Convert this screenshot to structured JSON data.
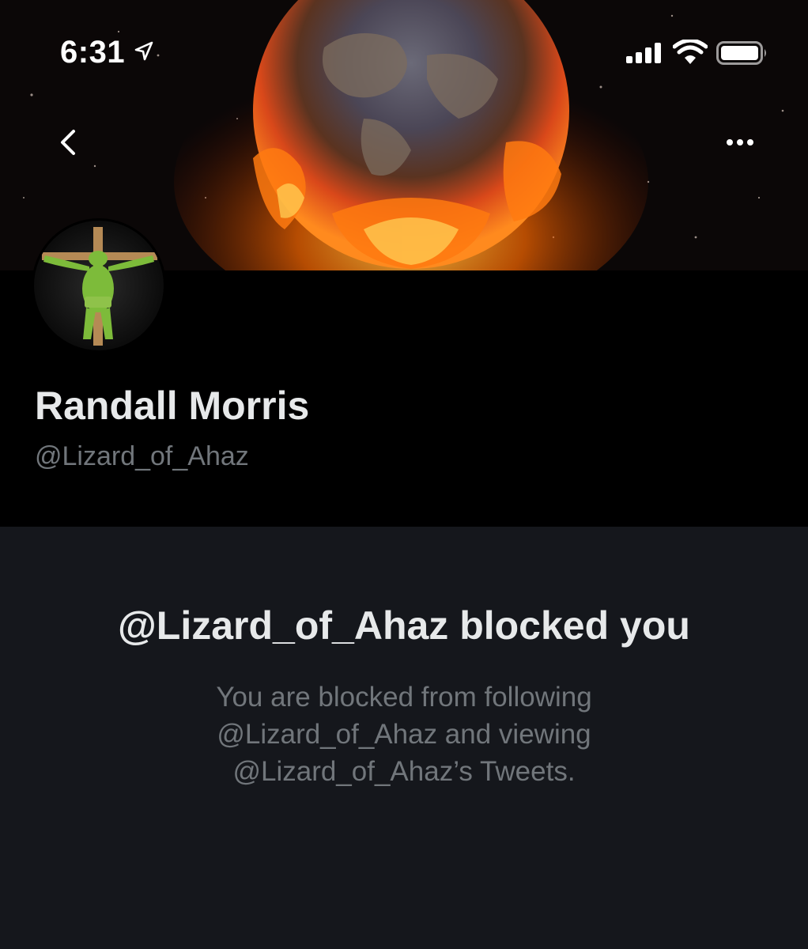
{
  "status_bar": {
    "time": "6:31",
    "icons": [
      "location-arrow-icon",
      "cellular-signal-icon",
      "wifi-icon",
      "battery-icon"
    ]
  },
  "nav": {
    "back_icon": "chevron-left-icon",
    "more_icon": "more-horizontal-icon"
  },
  "profile": {
    "display_name": "Randall Morris",
    "handle": "@Lizard_of_Ahaz"
  },
  "blocked": {
    "title": "@Lizard_of_Ahaz blocked you",
    "message_lines": [
      "You are blocked from following",
      "@Lizard_of_Ahaz and viewing",
      "@Lizard_of_Ahaz’s Tweets."
    ]
  },
  "colors": {
    "background": "#15171c",
    "header_background": "#000000",
    "primary_text": "#e7e9ea",
    "secondary_text": "#71767b",
    "banner_fire": "#ff6a00"
  }
}
